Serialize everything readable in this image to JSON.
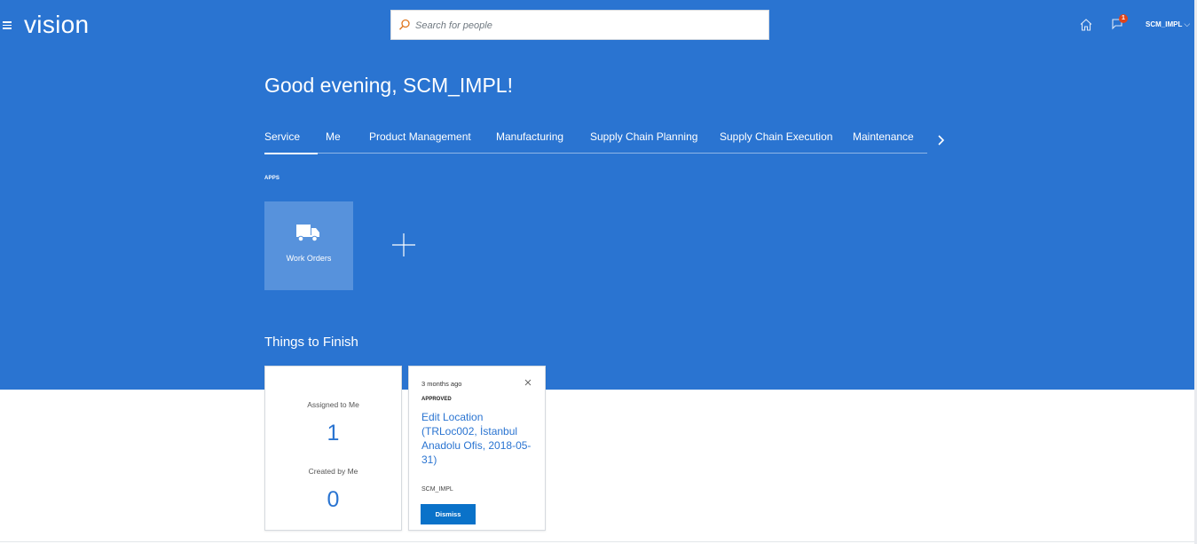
{
  "header": {
    "logo_text": "vision",
    "search": {
      "placeholder": "Search for people",
      "value": ""
    },
    "notifications": {
      "badge_count": "1"
    },
    "user_name": "SCM_IMPL"
  },
  "greeting": "Good evening, SCM_IMPL!",
  "tabs": [
    {
      "label": "Service",
      "active": true
    },
    {
      "label": "Me"
    },
    {
      "label": "Product Management"
    },
    {
      "label": "Manufacturing"
    },
    {
      "label": "Supply Chain Planning"
    },
    {
      "label": "Supply Chain Execution"
    },
    {
      "label": "Maintenance"
    }
  ],
  "apps": {
    "section_label": "APPS",
    "items": [
      {
        "label": "Work Orders",
        "icon": "truck-icon"
      }
    ]
  },
  "things_to_finish": {
    "title": "Things to Finish",
    "summary": {
      "assigned_label": "Assigned to Me",
      "assigned_count": "1",
      "created_label": "Created by Me",
      "created_count": "0"
    },
    "items": [
      {
        "time": "3 months ago",
        "status": "APPROVED",
        "title": "Edit Location (TRLoc002, İstanbul Anadolu Ofis, 2018-05-31)",
        "user": "SCM_IMPL",
        "dismiss_label": "Dismiss"
      }
    ]
  },
  "colors": {
    "hero_background": "#2a74d1",
    "link": "#2a74d1",
    "badge": "#e0451b",
    "dismiss_button": "#0a72c9"
  }
}
